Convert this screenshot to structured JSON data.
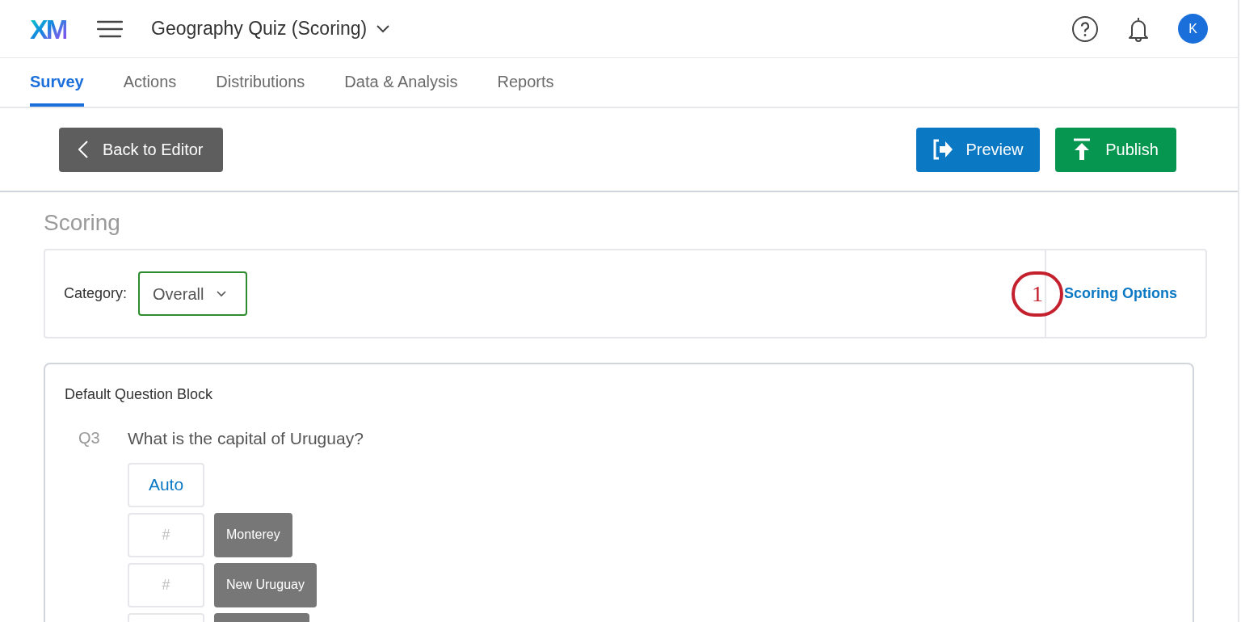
{
  "header": {
    "logo": "XM",
    "project_title": "Geography Quiz (Scoring)",
    "avatar": "K"
  },
  "tabs": [
    {
      "label": "Survey",
      "selected": true
    },
    {
      "label": "Actions",
      "selected": false
    },
    {
      "label": "Distributions",
      "selected": false
    },
    {
      "label": "Data & Analysis",
      "selected": false
    },
    {
      "label": "Reports",
      "selected": false
    }
  ],
  "toolbar": {
    "back_button": "Back to Editor",
    "preview_button": "Preview",
    "publish_button": "Publish"
  },
  "page_title": "Scoring",
  "category_bar": {
    "label": "Category:",
    "dropdown_value": "Overall",
    "callout": "1",
    "link": "Scoring Options"
  },
  "block": {
    "title": "Default Question Block",
    "question": {
      "number": "Q3",
      "text": "What is the capital of Uruguay?",
      "auto_button": "Auto",
      "choices": [
        {
          "points_placeholder": "#",
          "label": "Monterey"
        },
        {
          "points_placeholder": "#",
          "label": "New Uruguay"
        }
      ]
    }
  }
}
